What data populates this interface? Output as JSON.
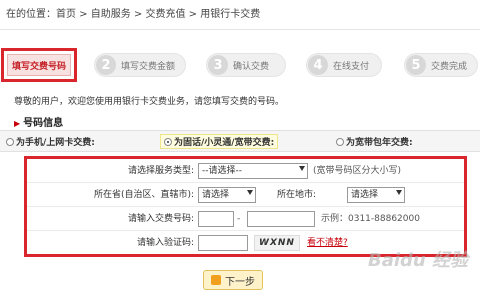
{
  "breadcrumb": {
    "text": "在的位置：首页 > 自助服务 > 交费充值 > 用银行卡交费"
  },
  "steps": [
    {
      "num": "",
      "label": "填写交费号码",
      "active": true
    },
    {
      "num": "2",
      "label": "填写交费金额"
    },
    {
      "num": "3",
      "label": "确认交费"
    },
    {
      "num": "4",
      "label": "在线支付"
    },
    {
      "num": "5",
      "label": "交费完成"
    }
  ],
  "notice": "尊敬的用户，欢迎您使用用银行卡交费业务，请您填写交费的号码。",
  "section": {
    "title": "号码信息"
  },
  "radios": [
    {
      "label": "为手机/上网卡交费:",
      "selected": false
    },
    {
      "label": "为固话/小灵通/宽带交费:",
      "selected": true
    },
    {
      "label": "为宽带包年交费:",
      "selected": false
    }
  ],
  "form": {
    "service_type": {
      "label": "请选择服务类型:",
      "value": "--请选择--",
      "hint": "(宽带号码区分大小写)"
    },
    "province": {
      "label": "所在省(自治区、直辖市):",
      "value": "请选择"
    },
    "city": {
      "label": "所在地市:",
      "value": "请选择"
    },
    "phone": {
      "label": "请输入交费号码:",
      "separator": "-",
      "example": "示例：0311-88862000"
    },
    "captcha": {
      "label": "请输入验证码:",
      "image_text": "WXNN",
      "link": "看不清楚?"
    }
  },
  "next_button": {
    "label": "下一步"
  },
  "watermark": "Baidu 经验"
}
